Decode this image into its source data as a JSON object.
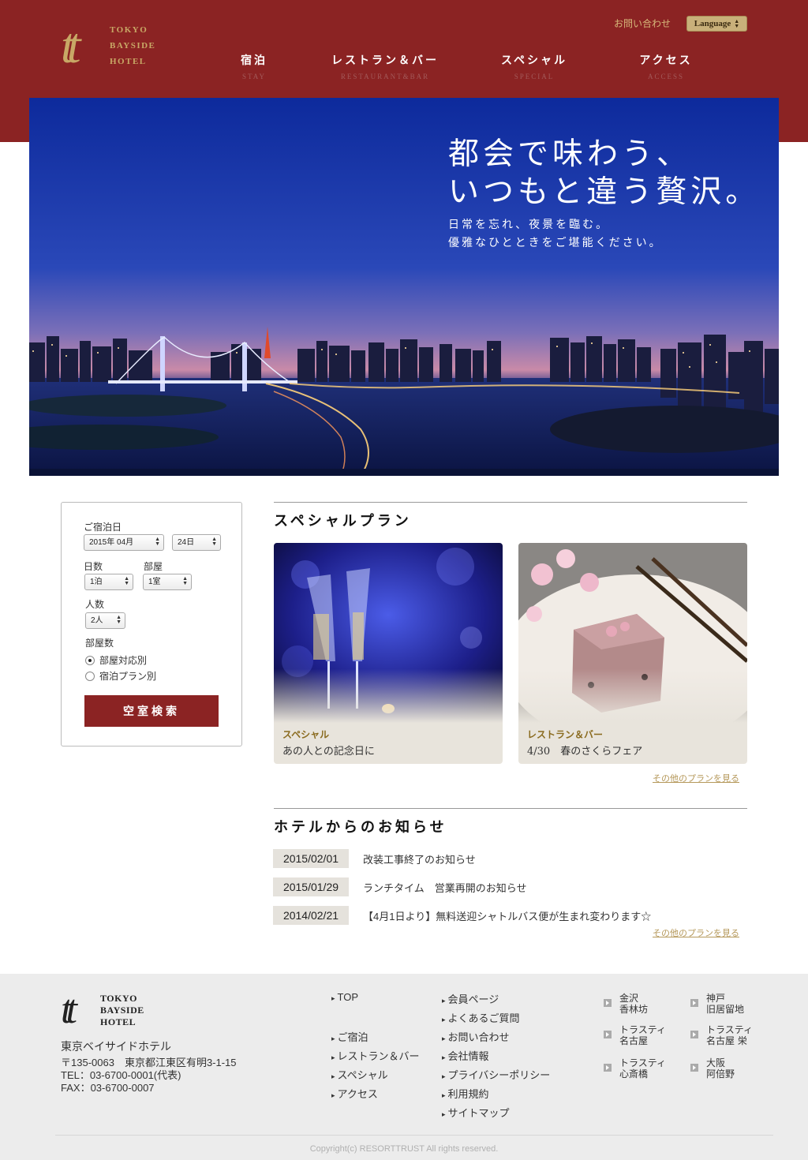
{
  "header": {
    "logo_mark": "tt",
    "logo_lines": [
      "TOKYO",
      "BAYSIDE",
      "HOTEL"
    ],
    "contact_link": "お問い合わせ",
    "language_button": "Language",
    "nav": [
      {
        "jp": "宿泊",
        "en": "STAY"
      },
      {
        "jp": "レストラン＆バー",
        "en": "RESTAURANT&BAR"
      },
      {
        "jp": "スペシャル",
        "en": "SPECIAL"
      },
      {
        "jp": "アクセス",
        "en": "ACCESS"
      }
    ]
  },
  "hero": {
    "title_line1": "都会で味わう、",
    "title_line2": "いつもと違う贅沢。",
    "sub_line1": "日常を忘れ、夜景を臨む。",
    "sub_line2": "優雅なひとときをご堪能ください。"
  },
  "booking": {
    "checkin_label": "ご宿泊日",
    "checkin_month": "2015年 04月",
    "checkin_day": "24日",
    "nights_label": "日数",
    "nights_value": "1泊",
    "rooms_label": "部屋",
    "rooms_value": "1室",
    "guests_label": "人数",
    "guests_value": "2人",
    "room_count_label": "部屋数",
    "option_by_room": "部屋対応別",
    "option_by_plan": "宿泊プラン別",
    "search_button": "空室検索"
  },
  "special": {
    "title": "スペシャルプラン",
    "cards": [
      {
        "category": "スペシャル",
        "title": "あの人との記念日に"
      },
      {
        "category": "レストラン＆バー",
        "title": "4/30　春のさくらフェア"
      }
    ],
    "more_link": "その他のプランを見る"
  },
  "news": {
    "title": "ホテルからのお知らせ",
    "items": [
      {
        "date": "2015/02/01",
        "text": "改装工事終了のお知らせ"
      },
      {
        "date": "2015/01/29",
        "text": "ランチタイム　営業再開のお知らせ"
      },
      {
        "date": "2014/02/21",
        "text": "【4月1日より】無料送迎シャトルバス便が生まれ変わります☆"
      }
    ],
    "more_link": "その他のプランを見る"
  },
  "footer": {
    "logo_lines": [
      "TOKYO",
      "BAYSIDE",
      "HOTEL"
    ],
    "hotel_name": "東京ベイサイドホテル",
    "address": "〒135-0063　東京都江東区有明3-1-15",
    "tel": "TEL：03-6700-0001(代表)",
    "fax": "FAX：03-6700-0007",
    "links_col1": [
      "TOP",
      "ご宿泊",
      "レストラン＆バー",
      "スペシャル",
      "アクセス"
    ],
    "links_col2": [
      "会員ページ",
      "よくあるご質問",
      "お問い合わせ",
      "会社情報",
      "プライバシーポリシー",
      "利用規約",
      "サイトマップ"
    ],
    "hotels": [
      [
        "金沢",
        "香林坊"
      ],
      [
        "神戸",
        "旧居留地"
      ],
      [
        "トラスティ",
        "名古屋"
      ],
      [
        "トラスティ",
        "名古屋 栄"
      ],
      [
        "トラスティ",
        "心斎橋"
      ],
      [
        "大阪",
        "阿倍野"
      ]
    ],
    "copyright": "Copyright(c) RESORTTRUST All rights reserved."
  },
  "colors": {
    "brand": "#8b2323",
    "gold": "#c8a866",
    "footer_bg": "#ececec"
  }
}
